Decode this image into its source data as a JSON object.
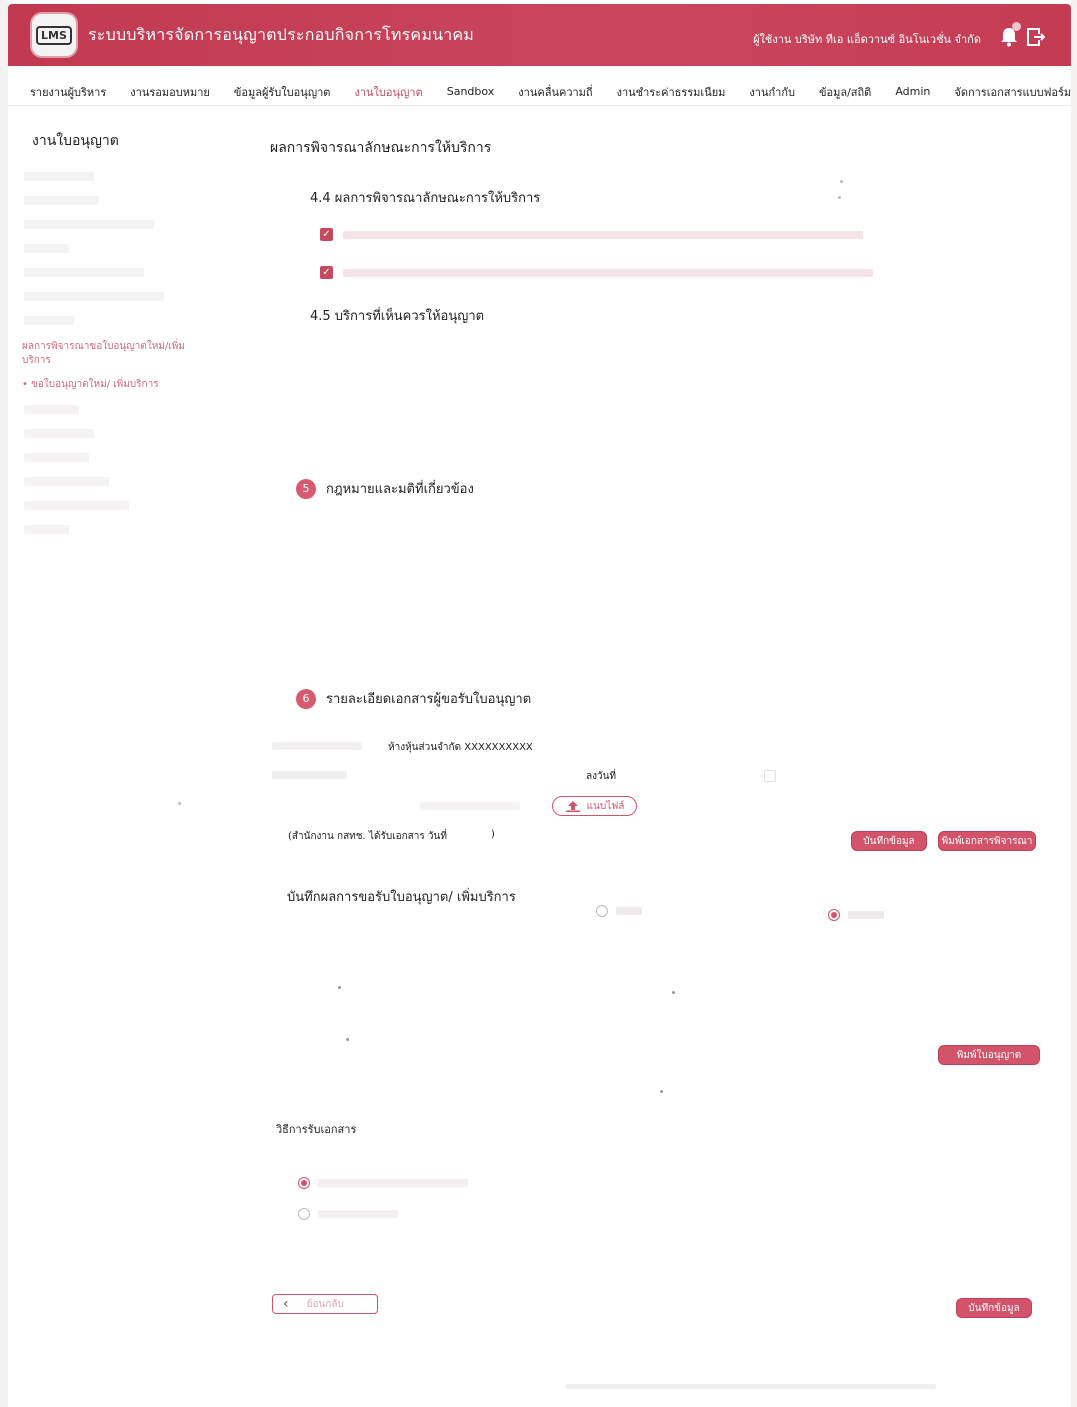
{
  "header": {
    "logo_text": "LMS",
    "app_title": "ระบบบริหารจัดการอนุญาตประกอบกิจการโทรคมนาคม",
    "user_info": "ผู้ใช้งาน บริษัท ทีเอ แอ็ดวานซ์ อินโนเวชั่น จำกัด"
  },
  "nav": {
    "items": [
      "รายงานผู้บริหาร",
      "งานรอมอบหมาย",
      "ข้อมูลผู้รับใบอนุญาต",
      "งานใบอนุญาต",
      "Sandbox",
      "งานคลื่นความถี่",
      "งานชำระค่าธรรมเนียม",
      "งานกำกับ",
      "ข้อมูล/สถิติ",
      "Admin",
      "จัดการเอกสารแบบฟอร์ม"
    ],
    "active_index": 3
  },
  "sidebar": {
    "title": "งานใบอนุญาต",
    "active_link": "ผลการพิจารณาขอใบอนุญาตใหม่/เพิ่มบริการ",
    "active_sub": "• ขอใบอนุญาตใหม่/ เพิ่มบริการ"
  },
  "main": {
    "heading": "ผลการพิจารณาลักษณะการให้บริการ",
    "sub_4_4": "4.4 ผลการพิจารณาลักษณะการให้บริการ",
    "sub_4_5": "4.5 บริการที่เห็นควรให้อนุญาต",
    "section5": {
      "num": "5",
      "title": "กฎหมายและมติที่เกี่ยวข้อง"
    },
    "section6": {
      "num": "6",
      "title": "รายละเอียดเอกสารผู้ขอรับใบอนุญาต"
    },
    "company_value": "ห้างหุ้นส่วนจำกัด XXXXXXXXXX",
    "date_label": "ลงวันที่",
    "upload_label": "แนบไฟล์",
    "office_note": "(สำนักงาน กสทช. ได้รับเอกสาร วันที่",
    "office_note_end": ")",
    "save_button": "บันทึกข้อมูล",
    "print_button": "พิมพ์เอกสารพิจารณา",
    "record_title": "บันทึกผลการขอรับใบอนุญาต/ เพิ่มบริการ",
    "print_license_button": "พิมพ์ใบอนุญาต",
    "doc_method_title": "วิธีการรับเอกสาร",
    "back_button": "ย้อนกลับ",
    "save_bottom_button": "บันทึกข้อมูล"
  }
}
